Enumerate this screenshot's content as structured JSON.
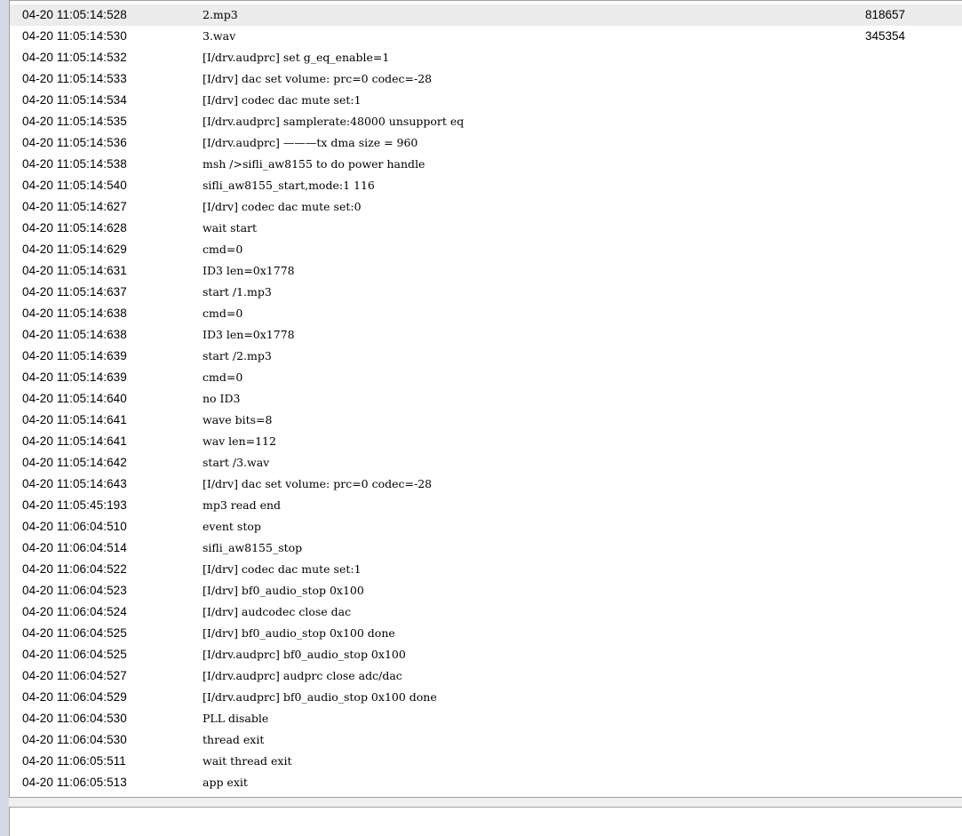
{
  "log": {
    "rows": [
      {
        "time": "04-20 11:05:14:528",
        "msg": "2.mp3",
        "size": "818657",
        "selected": true
      },
      {
        "time": "04-20 11:05:14:530",
        "msg": "3.wav",
        "size": "345354"
      },
      {
        "time": "04-20 11:05:14:532",
        "msg": "[I/drv.audprc] set g_eq_enable=1"
      },
      {
        "time": "04-20 11:05:14:533",
        "msg": "[I/drv] dac set volume: prc=0 codec=-28"
      },
      {
        "time": "04-20 11:05:14:534",
        "msg": "[I/drv] codec dac mute set:1"
      },
      {
        "time": "04-20 11:05:14:535",
        "msg": "[I/drv.audprc] samplerate:48000 unsupport eq"
      },
      {
        "time": "04-20 11:05:14:536",
        "msg": "[I/drv.audprc] ———tx dma size = 960"
      },
      {
        "time": "04-20 11:05:14:538",
        "msg": "msh />sifli_aw8155 to do power handle"
      },
      {
        "time": "04-20 11:05:14:540",
        "msg": "sifli_aw8155_start,mode:1 116"
      },
      {
        "time": "04-20 11:05:14:627",
        "msg": "[I/drv] codec dac mute set:0"
      },
      {
        "time": "04-20 11:05:14:628",
        "msg": "wait start"
      },
      {
        "time": "04-20 11:05:14:629",
        "msg": "cmd=0"
      },
      {
        "time": "04-20 11:05:14:631",
        "msg": "ID3 len=0x1778"
      },
      {
        "time": "04-20 11:05:14:637",
        "msg": "start /1.mp3"
      },
      {
        "time": "04-20 11:05:14:638",
        "msg": "cmd=0"
      },
      {
        "time": "04-20 11:05:14:638",
        "msg": "ID3 len=0x1778"
      },
      {
        "time": "04-20 11:05:14:639",
        "msg": "start /2.mp3"
      },
      {
        "time": "04-20 11:05:14:639",
        "msg": "cmd=0"
      },
      {
        "time": "04-20 11:05:14:640",
        "msg": "no ID3"
      },
      {
        "time": "04-20 11:05:14:641",
        "msg": "wave bits=8"
      },
      {
        "time": "04-20 11:05:14:641",
        "msg": "wav len=112"
      },
      {
        "time": "04-20 11:05:14:642",
        "msg": "start /3.wav"
      },
      {
        "time": "04-20 11:05:14:643",
        "msg": "[I/drv] dac set volume: prc=0 codec=-28"
      },
      {
        "time": "04-20 11:05:45:193",
        "msg": "mp3 read end"
      },
      {
        "time": "04-20 11:06:04:510",
        "msg": "event stop"
      },
      {
        "time": "04-20 11:06:04:514",
        "msg": "sifli_aw8155_stop"
      },
      {
        "time": "04-20 11:06:04:522",
        "msg": "[I/drv] codec dac mute set:1"
      },
      {
        "time": "04-20 11:06:04:523",
        "msg": "[I/drv] bf0_audio_stop 0x100"
      },
      {
        "time": "04-20 11:06:04:524",
        "msg": "[I/drv] audcodec close dac"
      },
      {
        "time": "04-20 11:06:04:525",
        "msg": "[I/drv] bf0_audio_stop 0x100 done"
      },
      {
        "time": "04-20 11:06:04:525",
        "msg": "[I/drv.audprc] bf0_audio_stop 0x100"
      },
      {
        "time": "04-20 11:06:04:527",
        "msg": "[I/drv.audprc] audprc close adc/dac"
      },
      {
        "time": "04-20 11:06:04:529",
        "msg": "[I/drv.audprc] bf0_audio_stop 0x100 done"
      },
      {
        "time": "04-20 11:06:04:530",
        "msg": "PLL disable"
      },
      {
        "time": "04-20 11:06:04:530",
        "msg": "thread exit"
      },
      {
        "time": "04-20 11:06:05:511",
        "msg": "wait thread exit"
      },
      {
        "time": "04-20 11:06:05:513",
        "msg": "app exit"
      }
    ]
  },
  "input": {
    "value": ""
  }
}
